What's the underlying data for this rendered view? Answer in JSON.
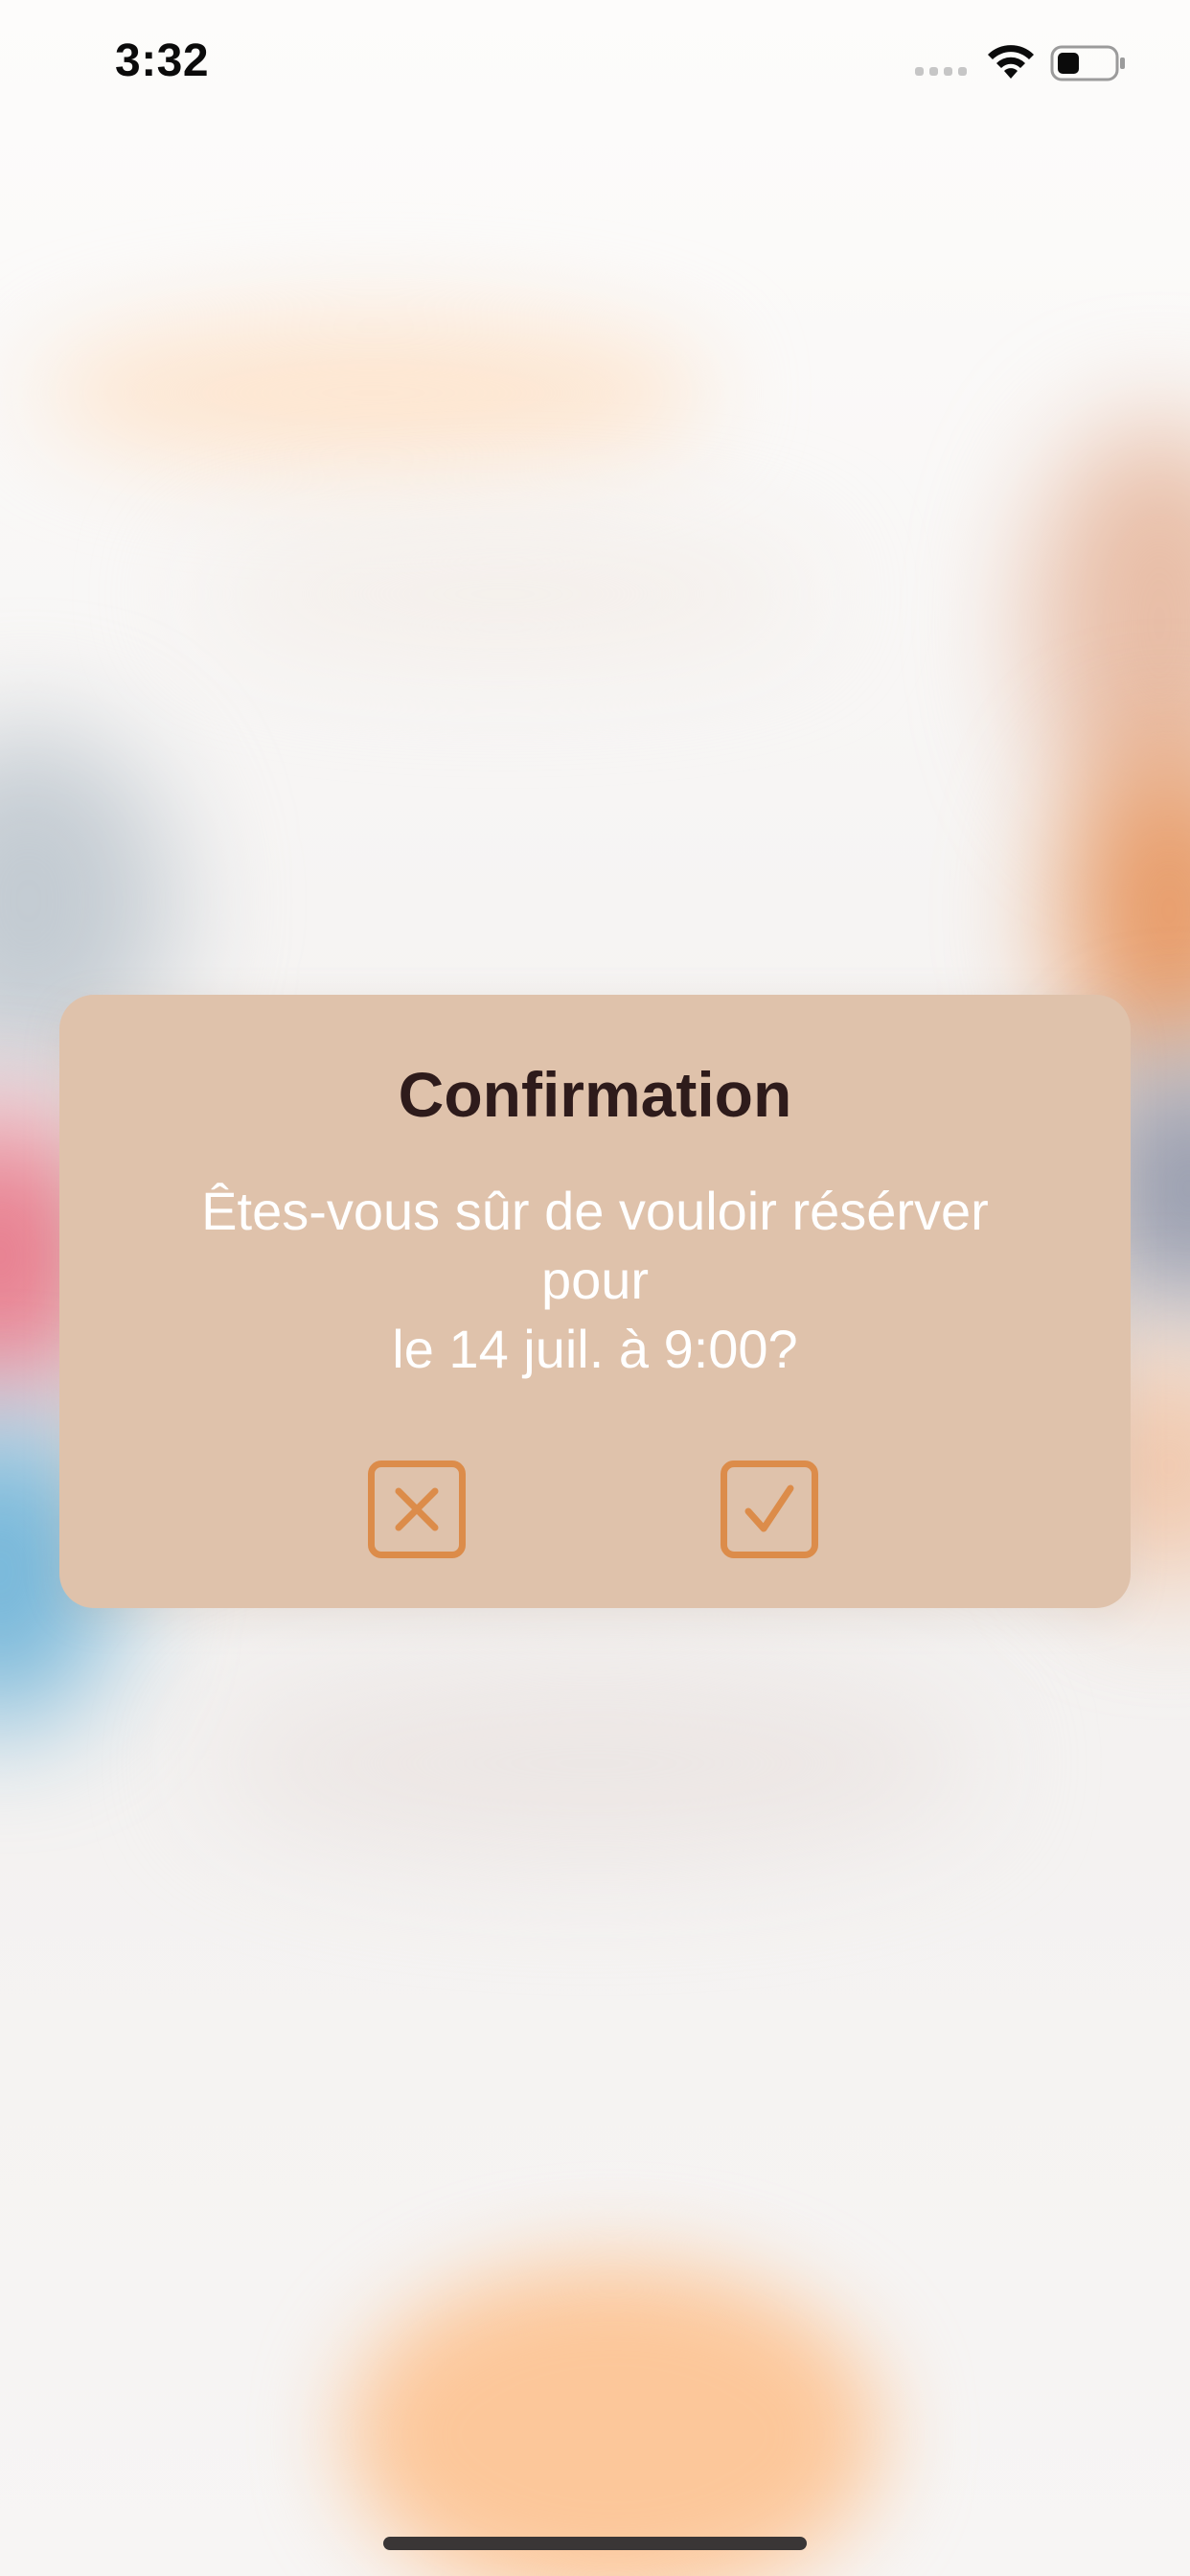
{
  "status_bar": {
    "time": "3:32",
    "icons": [
      "cellular-signal-icon",
      "wifi-icon",
      "battery-icon"
    ]
  },
  "dialog": {
    "title": "Confirmation",
    "message_lines": [
      "Êtes-vous sûr de vouloir résérver",
      "pour",
      "le 14 juil. à 9:00?"
    ],
    "cancel_icon": "close-icon",
    "confirm_icon": "checkmark-icon"
  },
  "colors": {
    "dialog_background": "#dfc2ab",
    "accent": "#dc8c4a",
    "title_text": "#2e1b1b",
    "message_text": "#ffffff"
  }
}
